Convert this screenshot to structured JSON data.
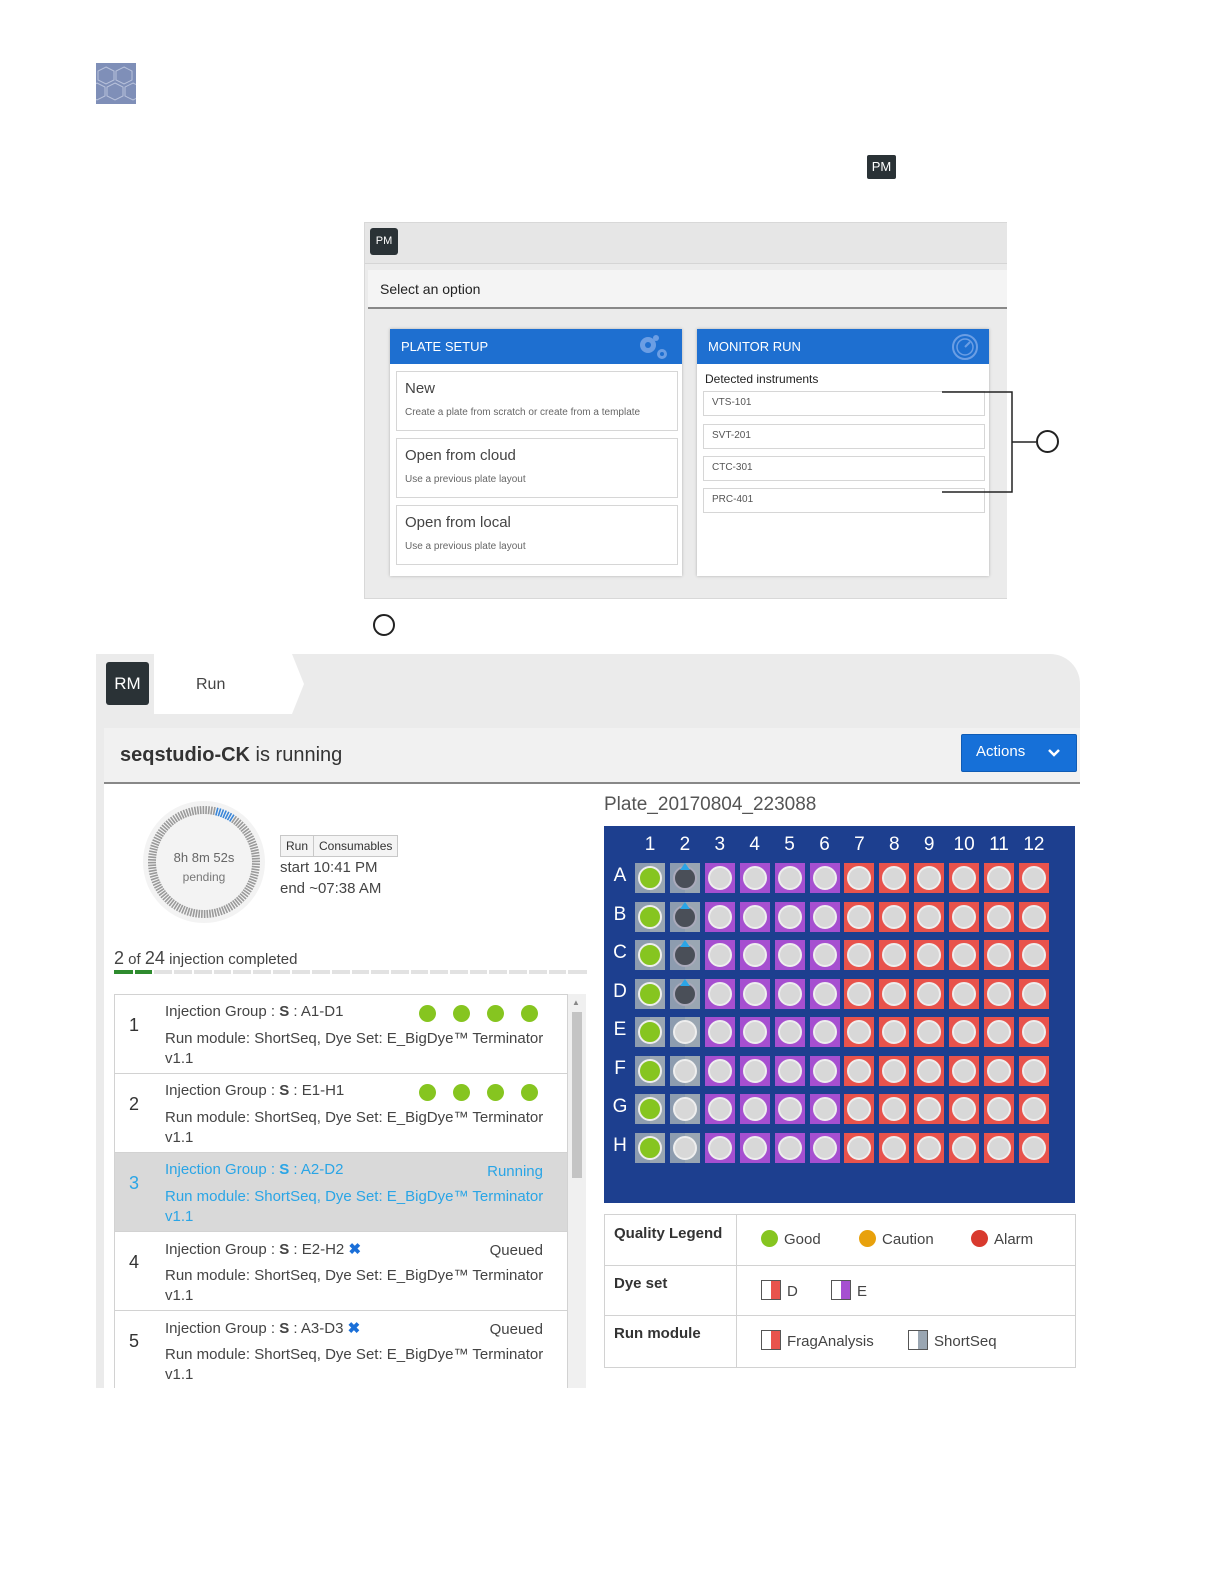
{
  "header": {
    "pm_badge": "PM"
  },
  "plate_manager": {
    "badge": "PM",
    "select_label": "Select an option",
    "plate_setup": {
      "title": "PLATE SETUP",
      "options": [
        {
          "title": "New",
          "subtitle": "Create a plate from scratch or create from a template"
        },
        {
          "title": "Open from cloud",
          "subtitle": "Use a previous plate layout"
        },
        {
          "title": "Open from local",
          "subtitle": "Use a previous plate layout"
        }
      ]
    },
    "monitor_run": {
      "title": "MONITOR RUN",
      "detected_label": "Detected instruments",
      "instruments": [
        "VTS-101",
        "SVT-201",
        "CTC-301",
        "PRC-401"
      ]
    }
  },
  "run_monitor": {
    "badge": "RM",
    "tab": "Run",
    "title_name": "seqstudio-CK",
    "title_suffix": " is running",
    "actions_label": "Actions",
    "timer": {
      "remaining": "8h 8m 52s",
      "status": "pending",
      "progress": 0.06
    },
    "segment": {
      "run": "Run",
      "consumables": "Consumables"
    },
    "start": "start 10:41 PM",
    "end": "end ~07:38 AM",
    "injections": {
      "done": "2",
      "of": " of ",
      "total": "24",
      "suffix": " injection completed",
      "segments": 24,
      "completed": 2
    },
    "list": [
      {
        "num": "1",
        "prefix": "Injection Group : ",
        "s": "S",
        "wells": " : A1-D1",
        "module": "Run module: ShortSeq, Dye Set: E_BigDye™ Terminator v1.1",
        "state": "",
        "dots": 4,
        "cancel": false,
        "active": false
      },
      {
        "num": "2",
        "prefix": "Injection Group : ",
        "s": "S",
        "wells": " : E1-H1",
        "module": "Run module: ShortSeq, Dye Set: E_BigDye™ Terminator v1.1",
        "state": "",
        "dots": 4,
        "cancel": false,
        "active": false
      },
      {
        "num": "3",
        "prefix": "Injection Group : ",
        "s": "S",
        "wells": " : A2-D2",
        "module": "Run module: ShortSeq, Dye Set: E_BigDye™ Terminator v1.1",
        "state": "Running",
        "dots": 0,
        "cancel": false,
        "active": true
      },
      {
        "num": "4",
        "prefix": "Injection Group : ",
        "s": "S",
        "wells": " : E2-H2",
        "module": "Run module: ShortSeq, Dye Set: E_BigDye™ Terminator v1.1",
        "state": "Queued",
        "dots": 0,
        "cancel": true,
        "active": false
      },
      {
        "num": "5",
        "prefix": "Injection Group : ",
        "s": "S",
        "wells": " : A3-D3",
        "module": "Run module: ShortSeq, Dye Set: E_BigDye™ Terminator v1.1",
        "state": "Queued",
        "dots": 0,
        "cancel": true,
        "active": false
      }
    ],
    "plate": {
      "name": "Plate_20170804_223088",
      "columns": [
        "1",
        "2",
        "3",
        "4",
        "5",
        "6",
        "7",
        "8",
        "9",
        "10",
        "11",
        "12"
      ],
      "rows": [
        "A",
        "B",
        "C",
        "D",
        "E",
        "F",
        "G",
        "H"
      ]
    },
    "legend": {
      "quality_label": "Quality Legend",
      "good": "Good",
      "caution": "Caution",
      "alarm": "Alarm",
      "dye_label": "Dye set",
      "dye_d": "D",
      "dye_e": "E",
      "module_label": "Run module",
      "frag": "FragAnalysis",
      "short": "ShortSeq"
    }
  },
  "colors": {
    "accent": "#1e6fd0",
    "good": "#86c520",
    "caution": "#e8a10c",
    "alarm": "#d83a2e",
    "plate_bg": "#1d3f8f",
    "dye_d": "#e8534c",
    "dye_e": "#a64fd0",
    "active_text": "#2aa5e6"
  }
}
